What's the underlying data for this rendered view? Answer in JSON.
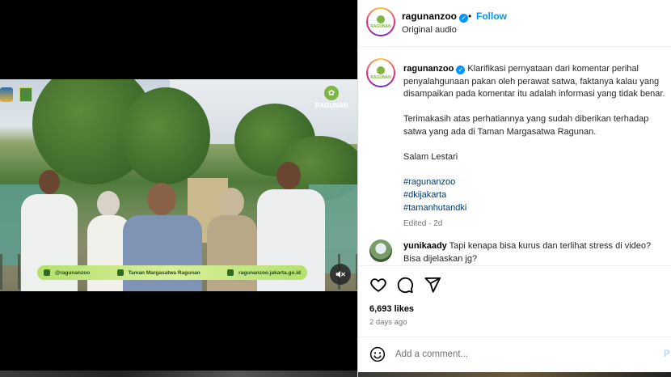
{
  "video": {
    "logo_text": "RAGUNAN",
    "lower_third": {
      "handle": "@ragunanzoo",
      "park_name": "Taman Margasatwa Ragunan",
      "website": "ragunanzoo.jakarta.go.id"
    },
    "mute_icon": "speaker-muted-icon"
  },
  "header": {
    "username": "ragunanzoo",
    "separator": "•",
    "follow_label": "Follow",
    "audio_label": "Original audio",
    "avatar_text": "RAGUNAN"
  },
  "caption": {
    "username": "ragunanzoo",
    "line1": " Klarifikasi pernyataan dari komentar perihal",
    "line2": "penyalahgunaan pakan oleh perawat satwa, faktanya kalau yang",
    "line3": "disampaikan pada komentar itu adalah informasi yang tidak benar.",
    "line4": "Terimakasih atas perhatiannya yang sudah diberikan terhadap",
    "line5": "satwa yang ada di Taman Margasatwa Ragunan.",
    "line6": "Salam Lestari",
    "hashtags": [
      "#ragunanzoo",
      "#dkijakarta",
      "#tamanhutandki"
    ],
    "edited": "Edited · 2d"
  },
  "comment": {
    "username": "yunikaady",
    "line1": " Tapi kenapa bisa kurus dan terlihat stress di video?",
    "line2": "Bisa dijelaskan jg?"
  },
  "actions": {
    "icons": [
      "heart-icon",
      "comment-icon",
      "share-icon"
    ],
    "likes": "6,693 likes",
    "time_ago": "2 days ago"
  },
  "add_comment": {
    "placeholder": "Add a comment...",
    "post_label": "P"
  },
  "colors": {
    "accent": "#0095f6",
    "hashtag": "#00376b",
    "muted": "#737373",
    "brand_green": "#7fb642"
  }
}
